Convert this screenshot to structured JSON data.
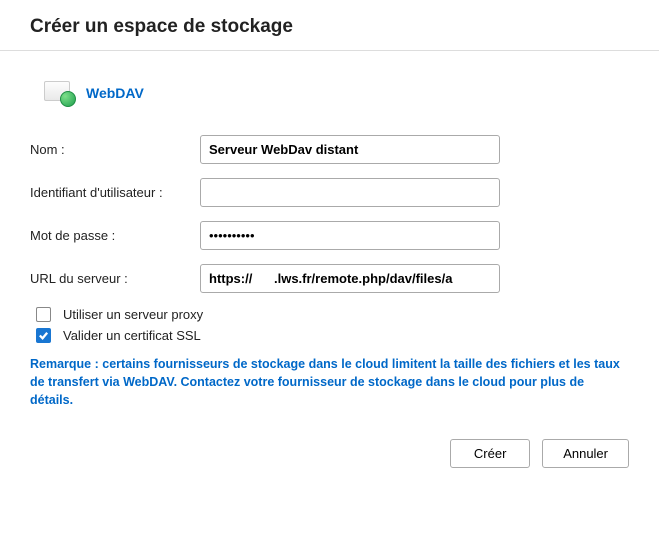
{
  "header": {
    "title": "Créer un espace de stockage"
  },
  "provider": {
    "name": "WebDAV"
  },
  "form": {
    "name_label": "Nom :",
    "name_value": "Serveur WebDav distant",
    "user_label": "Identifiant d'utilisateur :",
    "user_value": "",
    "password_label": "Mot de passe :",
    "password_value": "••••••••••",
    "url_label": "URL du serveur :",
    "url_value": "https://      .lws.fr/remote.php/dav/files/a"
  },
  "checkboxes": {
    "proxy": {
      "label": "Utiliser un serveur proxy",
      "checked": false
    },
    "ssl": {
      "label": "Valider un certificat SSL",
      "checked": true
    }
  },
  "note": "Remarque : certains fournisseurs de stockage dans le cloud limitent la taille des fichiers et les taux de transfert via WebDAV. Contactez votre fournisseur de stockage dans le cloud pour plus de détails.",
  "buttons": {
    "create": "Créer",
    "cancel": "Annuler"
  }
}
